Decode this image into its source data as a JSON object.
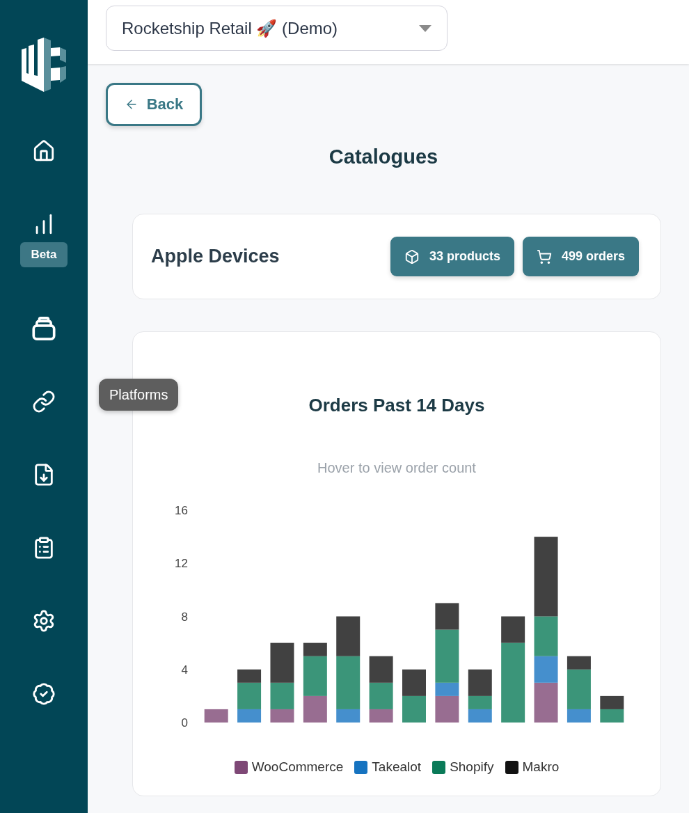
{
  "sidebar": {
    "badge": "Beta",
    "tooltip": "Platforms"
  },
  "header": {
    "account_select": {
      "value": "Rocketship Retail 🚀 (Demo)"
    }
  },
  "back_button": "Back",
  "page_title": "Catalogues",
  "catalogue": {
    "name": "Apple Devices",
    "stats": [
      {
        "kind": "products",
        "label": "33 products"
      },
      {
        "kind": "orders",
        "label": "499 orders"
      }
    ]
  },
  "orders_card": {
    "title": "Orders Past 14 Days",
    "subtitle": "Hover to view order count",
    "chart_data": {
      "type": "bar",
      "stacked": true,
      "ylim": [
        0,
        16
      ],
      "yticks": [
        0,
        4,
        8,
        12,
        16
      ],
      "series": [
        {
          "name": "WooCommerce",
          "color": "#7e4876",
          "values": [
            1,
            0,
            1,
            2,
            0,
            1,
            0,
            2,
            0,
            0,
            3,
            0,
            0
          ]
        },
        {
          "name": "Takealot",
          "color": "#1673c0",
          "values": [
            0,
            1,
            0,
            0,
            1,
            0,
            0,
            1,
            1,
            0,
            2,
            1,
            0
          ]
        },
        {
          "name": "Shopify",
          "color": "#0a7a58",
          "values": [
            0,
            2,
            2,
            3,
            4,
            2,
            2,
            4,
            1,
            6,
            3,
            3,
            1
          ]
        },
        {
          "name": "Makro",
          "color": "#111111",
          "values": [
            0,
            1,
            3,
            1,
            3,
            2,
            2,
            2,
            2,
            2,
            6,
            1,
            1
          ]
        }
      ]
    }
  }
}
